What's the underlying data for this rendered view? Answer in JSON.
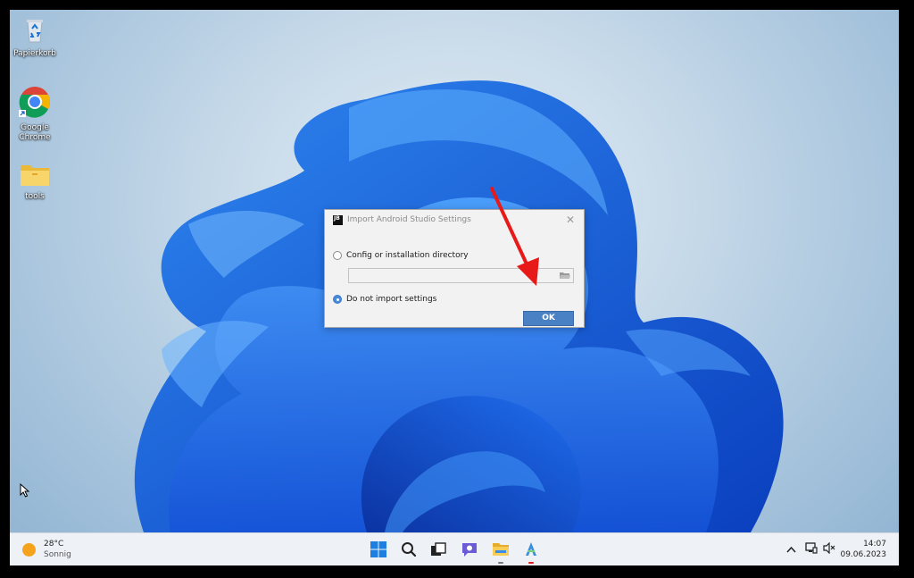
{
  "desktop": {
    "icons": [
      {
        "label": "Papierkorb",
        "icon": "recycle-bin-icon"
      },
      {
        "label": "Google Chrome",
        "icon": "chrome-icon"
      },
      {
        "label": "tools",
        "icon": "folder-icon"
      }
    ]
  },
  "dialog": {
    "logo_text": "JB",
    "title": "Import Android Studio Settings",
    "options": [
      {
        "label": "Config or installation directory",
        "selected": false
      },
      {
        "label": "Do not import settings",
        "selected": true
      }
    ],
    "path_value": "",
    "ok_label": "OK"
  },
  "taskbar": {
    "weather": {
      "temp": "28°C",
      "condition": "Sonnig"
    },
    "apps": [
      "windows-start-icon",
      "search-icon",
      "task-view-icon",
      "teams-chat-icon",
      "file-explorer-icon",
      "android-studio-icon"
    ],
    "tray": [
      "chevron-up-icon",
      "network-icon",
      "speaker-muted-icon"
    ],
    "clock": {
      "time": "14:07",
      "date": "09.06.2023"
    }
  },
  "colors": {
    "accent": "#4a80c4",
    "annotation_arrow": "#e81919",
    "taskbar": "#eef1f5"
  }
}
